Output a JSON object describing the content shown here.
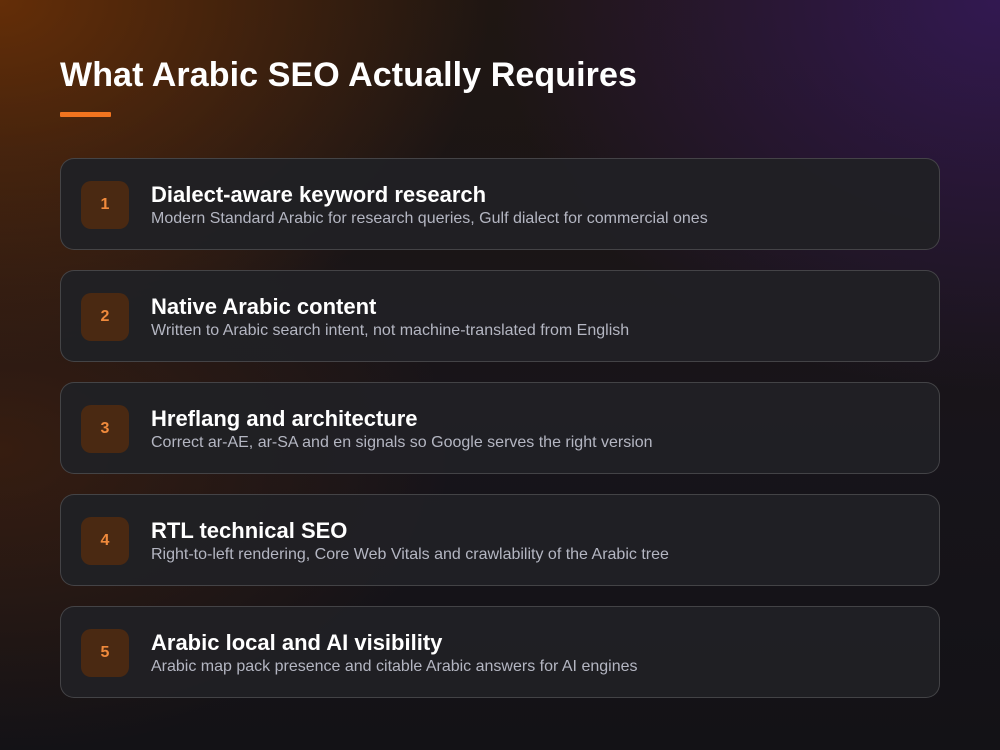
{
  "page": {
    "title": "What Arabic SEO Actually Requires",
    "accent_color": "#f2741f"
  },
  "items": [
    {
      "number": "1",
      "title": "Dialect-aware keyword research",
      "description": "Modern Standard Arabic for research queries, Gulf dialect for commercial ones"
    },
    {
      "number": "2",
      "title": "Native Arabic content",
      "description": "Written to Arabic search intent, not machine-translated from English"
    },
    {
      "number": "3",
      "title": "Hreflang and architecture",
      "description": "Correct ar-AE, ar-SA and en signals so Google serves the right version"
    },
    {
      "number": "4",
      "title": "RTL technical SEO",
      "description": "Right-to-left rendering, Core Web Vitals and crawlability of the Arabic tree"
    },
    {
      "number": "5",
      "title": "Arabic local and AI visibility",
      "description": "Arabic map pack presence and citable Arabic answers for AI engines"
    }
  ]
}
